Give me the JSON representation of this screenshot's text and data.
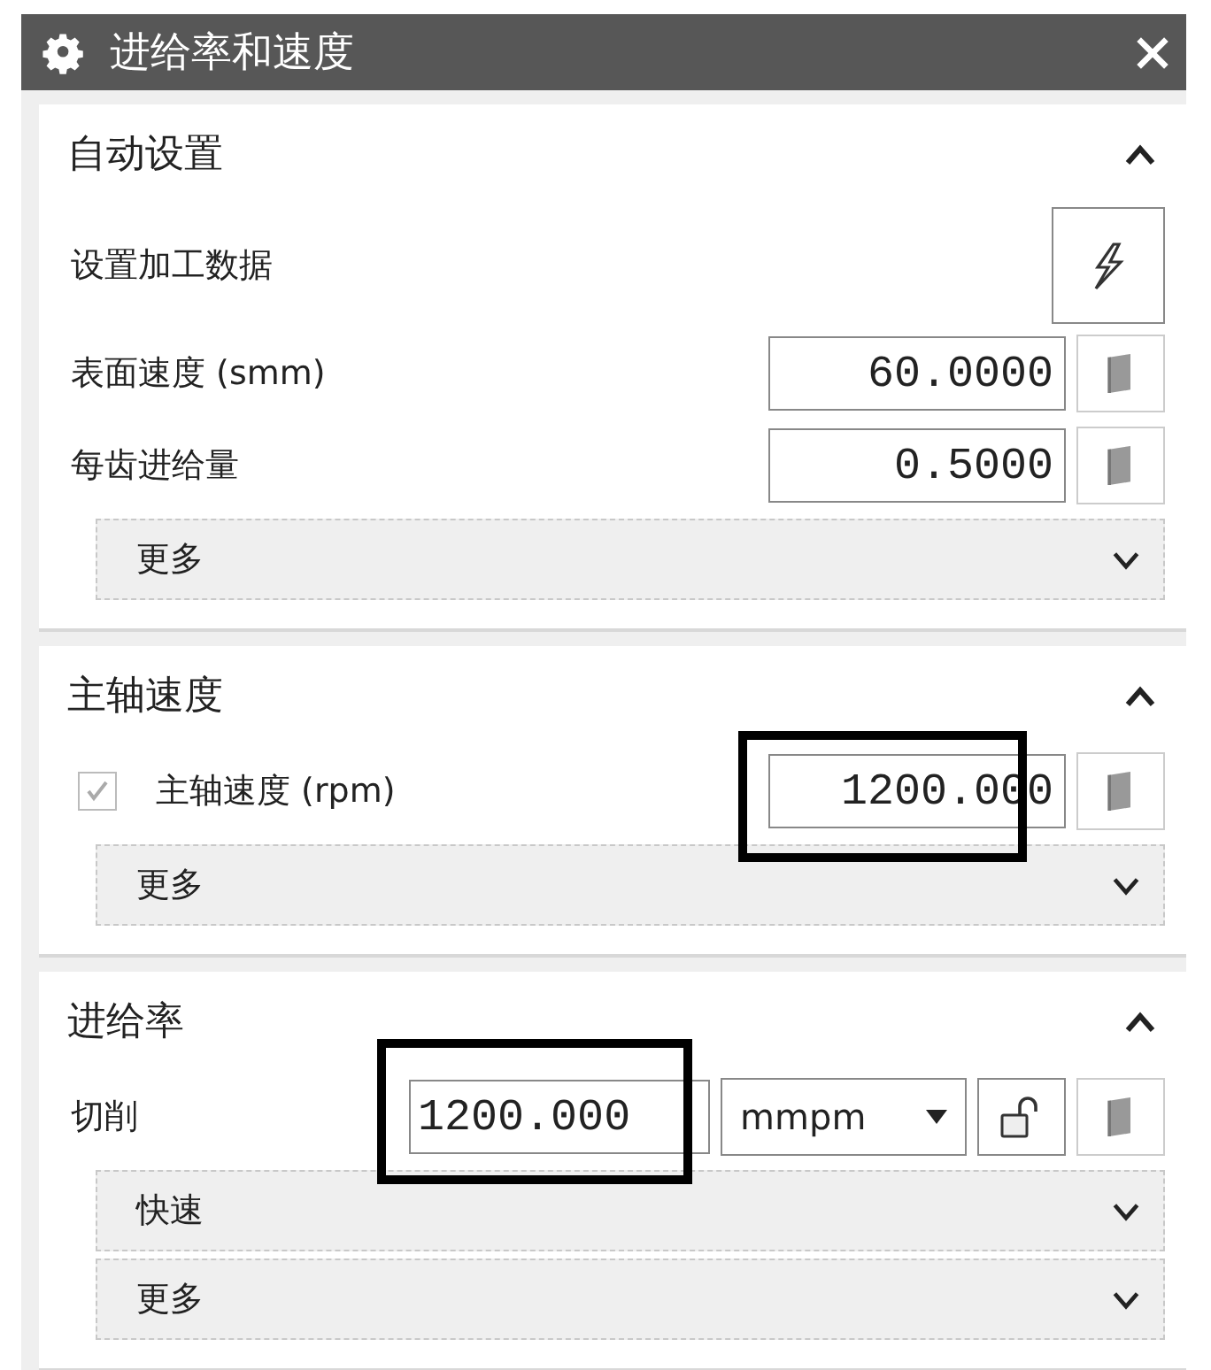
{
  "window": {
    "title": "进给率和速度"
  },
  "sections": [
    {
      "title": "自动设置",
      "expanded": true,
      "rows": [
        {
          "kind": "action",
          "label": "设置加工数据"
        },
        {
          "kind": "number",
          "label": "表面速度 (smm)",
          "value": "60.0000",
          "highlighted": false
        },
        {
          "kind": "number",
          "label": "每齿进给量",
          "value": "0.5000",
          "highlighted": false
        }
      ],
      "groups": [
        {
          "label": "更多",
          "expanded": false
        }
      ]
    },
    {
      "title": "主轴速度",
      "expanded": true,
      "rows": [
        {
          "kind": "checkbox_number",
          "label": "主轴速度 (rpm)",
          "checked": true,
          "disabled": true,
          "value": "1200.000",
          "highlighted": true
        }
      ],
      "groups": [
        {
          "label": "更多",
          "expanded": false
        }
      ]
    },
    {
      "title": "进给率",
      "expanded": true,
      "rows": [
        {
          "kind": "feed",
          "label": "切削",
          "value": "1200.000",
          "highlighted": true,
          "unit": "mmpm",
          "locked": false
        }
      ],
      "groups": [
        {
          "label": "快速",
          "expanded": false
        },
        {
          "label": "更多",
          "expanded": false
        }
      ]
    }
  ]
}
